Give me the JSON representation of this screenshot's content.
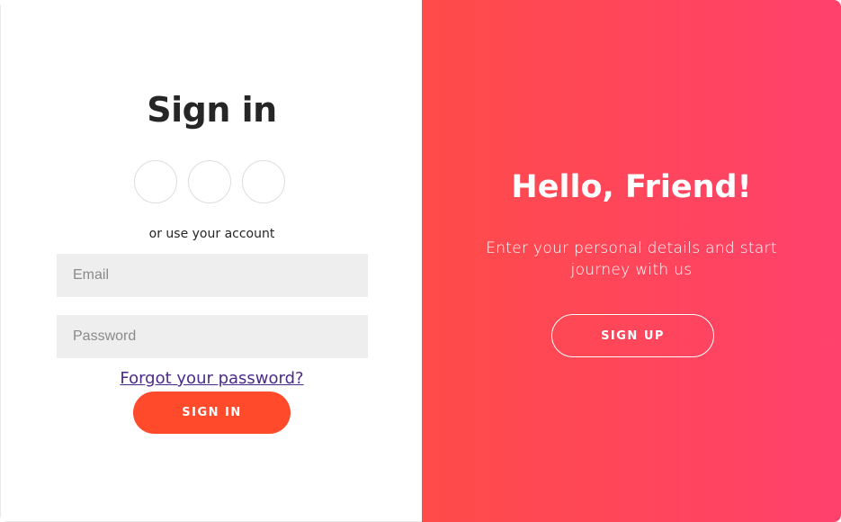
{
  "sign_in_panel": {
    "title": "Sign in",
    "social_icons": [
      "facebook-icon",
      "google-icon",
      "linkedin-icon"
    ],
    "alt_text": "or use your account",
    "email_placeholder": "Email",
    "password_placeholder": "Password",
    "forgot_link": "Forgot your password?",
    "sign_in_label": "SIGN IN"
  },
  "overlay_panel": {
    "title": "Hello, Friend!",
    "subtitle": "Enter your personal details and start journey with us",
    "sign_up_label": "SIGN UP"
  },
  "colors": {
    "accent": "#ff4b2b",
    "gradient_start": "#ff4b49",
    "gradient_end": "#ff416c",
    "input_bg": "#eeeeee"
  }
}
